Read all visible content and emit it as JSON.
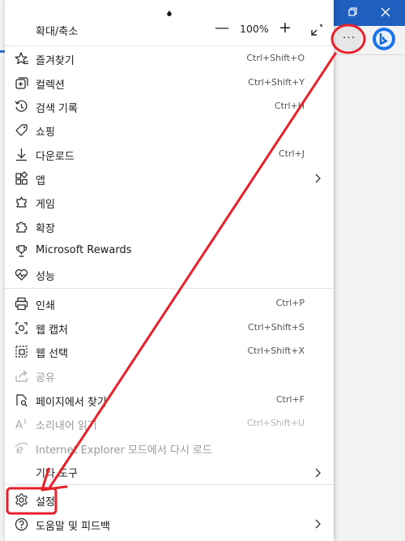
{
  "menu": {
    "zoom": {
      "label": "확대/축소",
      "minus": "—",
      "value": "100%",
      "plus": "+"
    },
    "items": [
      {
        "label": "즐겨찾기",
        "shortcut": "Ctrl+Shift+O"
      },
      {
        "label": "컬렉션",
        "shortcut": "Ctrl+Shift+Y"
      },
      {
        "label": "검색 기록",
        "shortcut": "Ctrl+H"
      },
      {
        "label": "쇼핑",
        "shortcut": ""
      },
      {
        "label": "다운로드",
        "shortcut": "Ctrl+J"
      },
      {
        "label": "앱",
        "shortcut": ""
      },
      {
        "label": "게임",
        "shortcut": ""
      },
      {
        "label": "확장",
        "shortcut": ""
      },
      {
        "label": "Microsoft Rewards",
        "shortcut": ""
      },
      {
        "label": "성능",
        "shortcut": ""
      },
      {
        "label": "인쇄",
        "shortcut": "Ctrl+P"
      },
      {
        "label": "웹 캡처",
        "shortcut": "Ctrl+Shift+S"
      },
      {
        "label": "웹 선택",
        "shortcut": "Ctrl+Shift+X"
      },
      {
        "label": "공유",
        "shortcut": ""
      },
      {
        "label": "페이지에서 찾기",
        "shortcut": "Ctrl+F"
      },
      {
        "label": "소리내어 읽기",
        "shortcut": "Ctrl+Shift+U"
      },
      {
        "label": "Internet Explorer 모드에서 다시 로드",
        "shortcut": ""
      },
      {
        "label": "기타 도구",
        "shortcut": ""
      },
      {
        "label": "설정",
        "shortcut": ""
      },
      {
        "label": "도움말 및 피드백",
        "shortcut": ""
      }
    ]
  },
  "toolbar": {
    "more_glyph": "···"
  },
  "colors": {
    "annotation": "#e8202a",
    "titlebar": "#1f5fbf",
    "bing": "#1a73e8"
  }
}
